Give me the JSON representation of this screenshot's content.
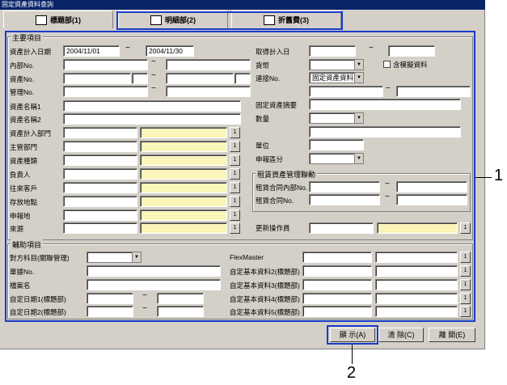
{
  "window": {
    "title": "固定資產資料查詢"
  },
  "tabs": [
    {
      "label": "標題部(1)",
      "icon": "book-icon"
    },
    {
      "label": "明細部(2)",
      "icon": "building-icon"
    },
    {
      "label": "折舊費(3)",
      "icon": "report-icon"
    }
  ],
  "main_group": {
    "title": "主要項目",
    "labels": {
      "date": "資產計入日期",
      "internal_no": "內部No.",
      "asset_no": "資產No.",
      "mgmt_no": "管理No.",
      "name1": "資產名稱1",
      "name2": "資產名稱2",
      "dept": "資產計入部門",
      "main_dept": "主管部門",
      "category": "資產種類",
      "person": "負責人",
      "client": "往來客戶",
      "location": "存放地點",
      "report_loc": "申報地",
      "source": "來源",
      "acq_date": "取得計入日",
      "currency": "貨幣",
      "include_sim": "含模擬資料",
      "link_no": "連接No.",
      "summary": "固定資產摘要",
      "qty": "數量",
      "unit": "單位",
      "report_cat": "申報區分",
      "lease_group": "租賃資產管理聯動",
      "lease_internal": "租賃合同內部No.",
      "lease_no": "租賃合同No.",
      "updater": "更新操作員"
    },
    "values": {
      "date_from": "2004/11/01",
      "date_to": "2004/11/30",
      "link_type": "固定資產資料"
    }
  },
  "aux_group": {
    "title": "輔助項目",
    "labels": {
      "account": "對方科目(關聯管理)",
      "voucher": "單據No.",
      "file": "檔案名",
      "custom_date1": "自定日期1(標題部)",
      "custom_date2": "自定日期2(標題部)",
      "flexmaster": "FlexMaster",
      "basic2": "自定基本資料2(標題部)",
      "basic3": "自定基本資料3(標題部)",
      "basic4": "自定基本資料4(標題部)",
      "basic5": "自定基本資料5(標題部)"
    }
  },
  "tilde": "~",
  "lookup_btn": "1",
  "buttons": {
    "show": "顯 示(A)",
    "clear": "清 除(C)",
    "close": "離 開(E)"
  },
  "callouts": {
    "one": "1",
    "two": "2"
  }
}
